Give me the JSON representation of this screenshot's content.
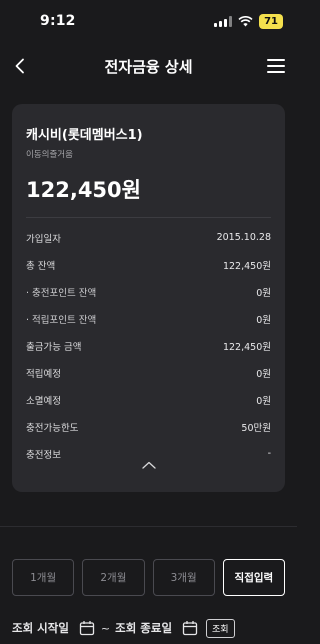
{
  "status": {
    "time": "9:12",
    "battery": "71"
  },
  "nav": {
    "title": "전자금융 상세"
  },
  "card": {
    "name": "캐시비(롯데멤버스1)",
    "subtitle": "이동의즐거움",
    "amount": "122,450원",
    "rows": [
      {
        "label": "가입일자",
        "value": "2015.10.28"
      },
      {
        "label": "총 잔액",
        "value": "122,450원"
      },
      {
        "label": "· 충전포인트 잔액",
        "value": "0원"
      },
      {
        "label": "· 적립포인트 잔액",
        "value": "0원"
      },
      {
        "label": "출금가능 금액",
        "value": "122,450원"
      },
      {
        "label": "적립예정",
        "value": "0원"
      },
      {
        "label": "소멸예정",
        "value": "0원"
      },
      {
        "label": "충전가능한도",
        "value": "50만원"
      },
      {
        "label": "충전정보",
        "value": "-"
      }
    ]
  },
  "period_tabs": [
    {
      "label": "1개월",
      "selected": false
    },
    {
      "label": "2개월",
      "selected": false
    },
    {
      "label": "3개월",
      "selected": false
    },
    {
      "label": "직접입력",
      "selected": true
    }
  ],
  "date_range": {
    "start_label": "조회 시작일",
    "separator": "~",
    "end_label": "조회 종료일",
    "search_label": "조회"
  },
  "colors": {
    "background": "#1a1a1c",
    "card": "#2a2a2e",
    "battery": "#f4e04d"
  },
  "icons": [
    "back-arrow-icon",
    "hamburger-menu-icon",
    "chevron-up-icon",
    "calendar-icon",
    "wifi-icon",
    "signal-icon"
  ]
}
